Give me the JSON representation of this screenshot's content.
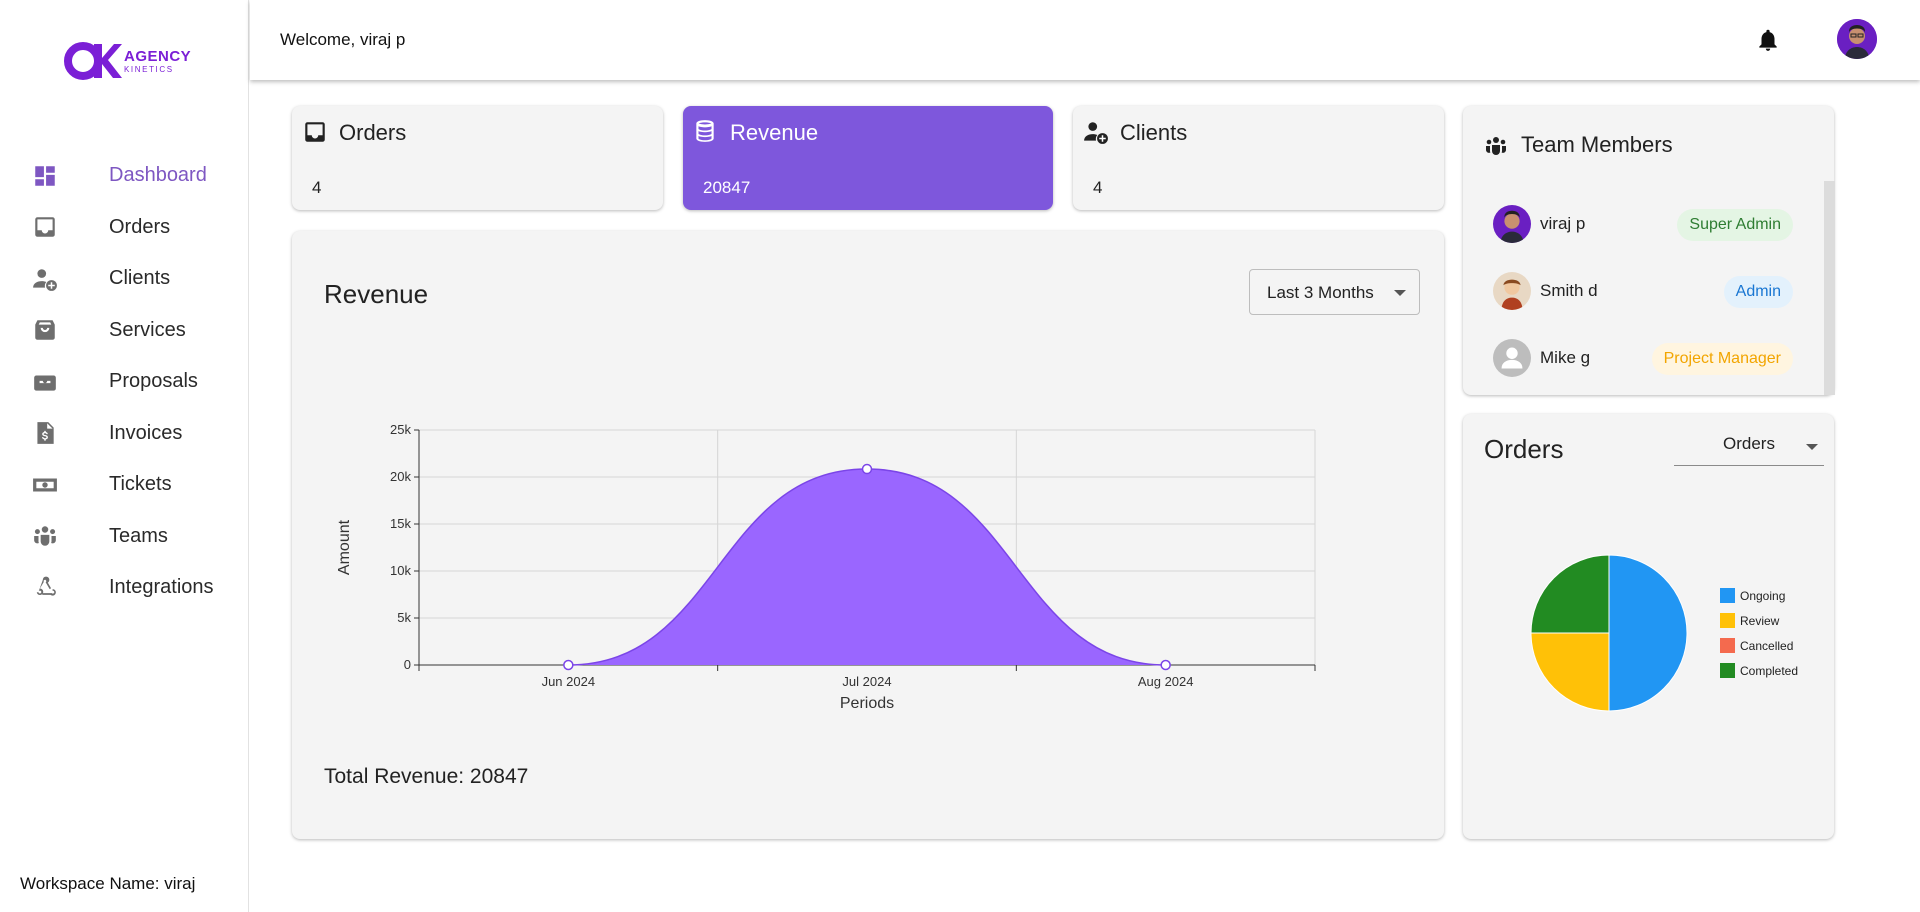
{
  "brand": {
    "line1": "AGENCY",
    "line2": "KINETICS",
    "color": "#7b1fd6"
  },
  "sidebar": {
    "items": [
      {
        "label": "Dashboard",
        "icon": "dashboard-icon",
        "active": true
      },
      {
        "label": "Orders",
        "icon": "inbox-icon"
      },
      {
        "label": "Clients",
        "icon": "add-user-icon"
      },
      {
        "label": "Services",
        "icon": "shopping-bag-icon"
      },
      {
        "label": "Proposals",
        "icon": "mailbox-icon"
      },
      {
        "label": "Invoices",
        "icon": "invoice-dollar-icon"
      },
      {
        "label": "Tickets",
        "icon": "ticket-money-icon"
      },
      {
        "label": "Teams",
        "icon": "teams-icon"
      },
      {
        "label": "Integrations",
        "icon": "webhook-icon"
      }
    ],
    "workspace": "Workspace Name: viraj"
  },
  "header": {
    "welcome": "Welcome, viraj p"
  },
  "stats": [
    {
      "title": "Orders",
      "value": "4",
      "icon": "inbox-icon"
    },
    {
      "title": "Revenue",
      "value": "20847",
      "icon": "database-icon",
      "highlight": "#7e57dc"
    },
    {
      "title": "Clients",
      "value": "4",
      "icon": "add-user-icon"
    }
  ],
  "revenue": {
    "title": "Revenue",
    "range_label": "Last 3 Months",
    "total": "Total Revenue: 20847"
  },
  "team": {
    "title": "Team Members",
    "members": [
      {
        "name": "viraj p",
        "role": "Super Admin"
      },
      {
        "name": "Smith d",
        "role": "Admin"
      },
      {
        "name": "Mike g",
        "role": "Project Manager"
      }
    ]
  },
  "orders_panel": {
    "title": "Orders",
    "select_label": "Orders"
  },
  "chart_data": [
    {
      "type": "area",
      "x": [
        "Jun 2024",
        "Jul 2024",
        "Aug 2024"
      ],
      "series": [
        {
          "values": [
            0,
            20847,
            0
          ],
          "color": "#9a66ff"
        }
      ],
      "xlabel": "Periods",
      "ylabel": "Amount",
      "ylim": [
        0,
        25000
      ],
      "yticks": [
        "0",
        "5k",
        "10k",
        "15k",
        "20k",
        "25k"
      ],
      "grid": true
    },
    {
      "type": "pie",
      "categories": [
        "Ongoing",
        "Review",
        "Cancelled",
        "Completed"
      ],
      "values": [
        2,
        1,
        0,
        1
      ],
      "colors": [
        "#2196f3",
        "#ffc107",
        "#f46a4e",
        "#228b22"
      ],
      "legend": "right"
    }
  ]
}
